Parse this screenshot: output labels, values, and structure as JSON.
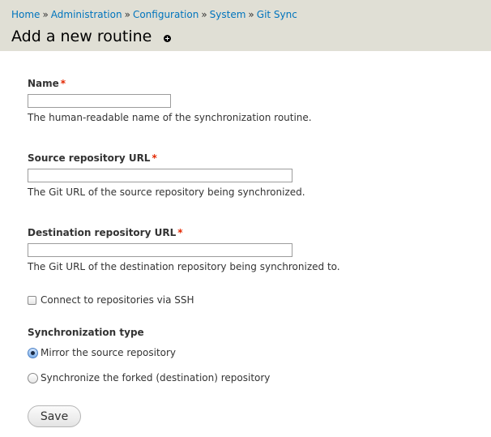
{
  "breadcrumb": {
    "items": [
      "Home",
      "Administration",
      "Configuration",
      "System",
      "Git Sync"
    ],
    "separator": "»"
  },
  "page": {
    "title": "Add a new routine"
  },
  "form": {
    "required_marker": "*",
    "name": {
      "label": "Name",
      "value": "",
      "description": "The human-readable name of the synchronization routine."
    },
    "source": {
      "label": "Source repository URL",
      "value": "",
      "description": "The Git URL of the source repository being synchronized."
    },
    "destination": {
      "label": "Destination repository URL",
      "value": "",
      "description": "The Git URL of the destination repository being synchronized to."
    },
    "ssh": {
      "label": "Connect to repositories via SSH",
      "checked": false
    },
    "sync_type": {
      "label": "Synchronization type",
      "options": [
        {
          "label": "Mirror the source repository",
          "selected": true
        },
        {
          "label": "Synchronize the forked (destination) repository",
          "selected": false
        }
      ]
    },
    "save_label": "Save"
  },
  "colors": {
    "header_bg": "#e0dfd5",
    "link": "#0074bd",
    "required": "#e32700"
  },
  "icons": {
    "shortcut": "add-shortcut-icon"
  }
}
